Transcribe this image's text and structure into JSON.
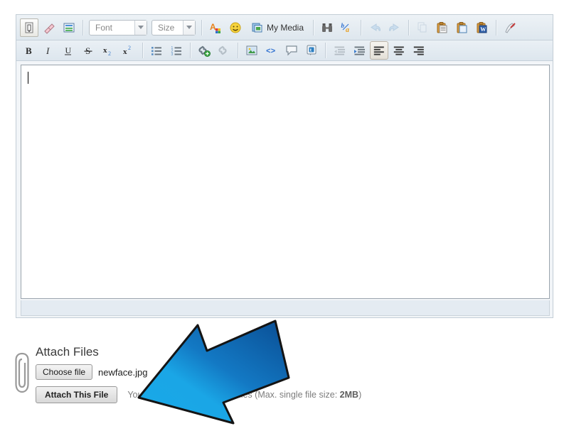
{
  "editor": {
    "toolbar_row1": [
      {
        "name": "source-toggle-icon",
        "label": "",
        "icon": "source",
        "state": "framed",
        "interactable": true
      },
      {
        "name": "remove-format-icon",
        "label": "",
        "icon": "eraser",
        "state": "normal",
        "interactable": true
      },
      {
        "name": "templates-icon",
        "label": "",
        "icon": "template",
        "state": "normal",
        "interactable": true
      },
      {
        "name": "separator",
        "label": "",
        "icon": "sep",
        "state": "sep",
        "interactable": false
      },
      {
        "name": "font-family-select",
        "label": "Font",
        "icon": "dropdown-font",
        "state": "dropdown",
        "interactable": true
      },
      {
        "name": "font-size-select",
        "label": "Size",
        "icon": "dropdown-size",
        "state": "dropdown",
        "interactable": true
      },
      {
        "name": "separator",
        "label": "",
        "icon": "sep",
        "state": "sep",
        "interactable": false
      },
      {
        "name": "text-color-icon",
        "label": "",
        "icon": "textcolor",
        "state": "normal",
        "interactable": true
      },
      {
        "name": "emoticon-icon",
        "label": "",
        "icon": "smiley",
        "state": "normal",
        "interactable": true
      },
      {
        "name": "my-media-button",
        "label": "My Media",
        "icon": "media",
        "state": "text",
        "interactable": true
      },
      {
        "name": "separator",
        "label": "",
        "icon": "sep",
        "state": "sep",
        "interactable": false
      },
      {
        "name": "find-replace-icon",
        "label": "",
        "icon": "binocular",
        "state": "normal",
        "interactable": true
      },
      {
        "name": "spellcheck-icon",
        "label": "",
        "icon": "spell",
        "state": "normal",
        "interactable": true
      },
      {
        "name": "separator",
        "label": "",
        "icon": "sep",
        "state": "sep",
        "interactable": false
      },
      {
        "name": "undo-icon",
        "label": "",
        "icon": "undo",
        "state": "disabled",
        "interactable": true
      },
      {
        "name": "redo-icon",
        "label": "",
        "icon": "redo",
        "state": "disabled",
        "interactable": true
      },
      {
        "name": "separator",
        "label": "",
        "icon": "sep",
        "state": "sep",
        "interactable": false
      },
      {
        "name": "copy-icon",
        "label": "",
        "icon": "copy",
        "state": "disabled",
        "interactable": true
      },
      {
        "name": "paste-icon",
        "label": "",
        "icon": "paste",
        "state": "normal",
        "interactable": true
      },
      {
        "name": "paste-text-icon",
        "label": "",
        "icon": "paste-text",
        "state": "normal",
        "interactable": true
      },
      {
        "name": "paste-word-icon",
        "label": "",
        "icon": "paste-word",
        "state": "normal",
        "interactable": true
      },
      {
        "name": "separator",
        "label": "",
        "icon": "sep",
        "state": "sep",
        "interactable": false
      },
      {
        "name": "clean-formatting-icon",
        "label": "",
        "icon": "broom",
        "state": "normal",
        "interactable": true
      }
    ],
    "toolbar_row2": [
      {
        "name": "bold-button",
        "label": "B",
        "icon": "bold",
        "state": "normal",
        "interactable": true
      },
      {
        "name": "italic-button",
        "label": "I",
        "icon": "italic",
        "state": "normal",
        "interactable": true
      },
      {
        "name": "underline-button",
        "label": "U",
        "icon": "underline",
        "state": "normal",
        "interactable": true
      },
      {
        "name": "strikethrough-button",
        "label": "S",
        "icon": "strike",
        "state": "normal",
        "interactable": true
      },
      {
        "name": "subscript-button",
        "label": "x",
        "icon": "subscript",
        "state": "normal",
        "interactable": true
      },
      {
        "name": "superscript-button",
        "label": "x",
        "icon": "superscript",
        "state": "normal",
        "interactable": true
      },
      {
        "name": "separator",
        "label": "",
        "icon": "sep",
        "state": "sep",
        "interactable": false
      },
      {
        "name": "bullet-list-button",
        "label": "",
        "icon": "ul",
        "state": "normal",
        "interactable": true
      },
      {
        "name": "numbered-list-button",
        "label": "",
        "icon": "ol",
        "state": "normal",
        "interactable": true
      },
      {
        "name": "separator",
        "label": "",
        "icon": "sep",
        "state": "sep",
        "interactable": false
      },
      {
        "name": "insert-link-icon",
        "label": "",
        "icon": "link-add",
        "state": "normal",
        "interactable": true
      },
      {
        "name": "unlink-icon",
        "label": "",
        "icon": "unlink",
        "state": "disabled",
        "interactable": true
      },
      {
        "name": "separator",
        "label": "",
        "icon": "sep",
        "state": "sep",
        "interactable": false
      },
      {
        "name": "insert-image-icon",
        "label": "",
        "icon": "image",
        "state": "normal",
        "interactable": true
      },
      {
        "name": "insert-code-icon",
        "label": "",
        "icon": "code",
        "state": "normal",
        "interactable": true
      },
      {
        "name": "insert-quote-icon",
        "label": "",
        "icon": "quote",
        "state": "normal",
        "interactable": true
      },
      {
        "name": "insert-tweet-icon",
        "label": "",
        "icon": "tweet",
        "state": "normal",
        "interactable": true
      },
      {
        "name": "separator",
        "label": "",
        "icon": "sep",
        "state": "sep",
        "interactable": false
      },
      {
        "name": "outdent-button",
        "label": "",
        "icon": "outdent",
        "state": "disabled",
        "interactable": true
      },
      {
        "name": "indent-button",
        "label": "",
        "icon": "indent",
        "state": "normal",
        "interactable": true
      },
      {
        "name": "align-left-button",
        "label": "",
        "icon": "align-left",
        "state": "active",
        "interactable": true
      },
      {
        "name": "align-center-button",
        "label": "",
        "icon": "align-center",
        "state": "normal",
        "interactable": true
      },
      {
        "name": "align-right-button",
        "label": "",
        "icon": "align-right",
        "state": "normal",
        "interactable": true
      }
    ],
    "content": "",
    "font_placeholder": "Font",
    "size_placeholder": "Size"
  },
  "attach": {
    "title": "Attach Files",
    "choose_file_label": "Choose file",
    "file_name": "newface.jpg",
    "attach_button_label": "Attach This File",
    "note_prefix": "You can attach unlimited of files (Max. single file size: ",
    "note_size": "2MB",
    "note_suffix": ")"
  },
  "colors": {
    "toolbar_top": "#edf2f6",
    "toolbar_bottom": "#dee7ee",
    "frame_border": "#c3cdd6",
    "arrow_light": "#22b2ee",
    "arrow_dark": "#0c5fa5",
    "arrow_outline": "#111111"
  }
}
